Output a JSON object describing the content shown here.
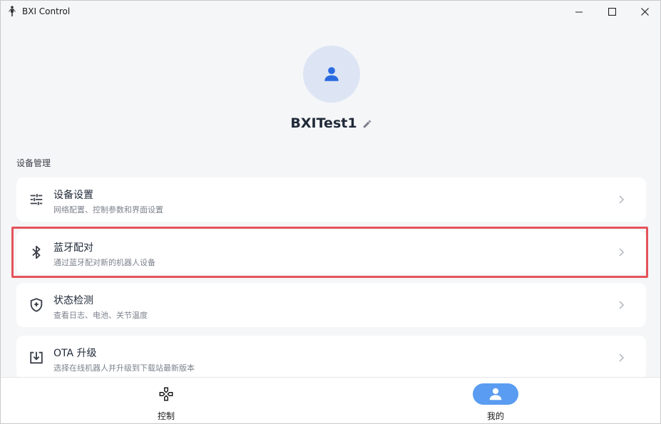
{
  "window": {
    "title": "BXI Control",
    "app_icon": "robot-figure-icon",
    "controls": [
      "minimize-icon",
      "maximize-icon",
      "close-icon"
    ]
  },
  "profile": {
    "avatar_icon": "person-icon",
    "username": "BXITest1",
    "edit_icon": "pencil-icon"
  },
  "section": {
    "label": "设备管理"
  },
  "cards": [
    {
      "icon": "sliders-icon",
      "title": "设备设置",
      "subtitle": "网络配置、控制参数和界面设置"
    },
    {
      "icon": "bluetooth-icon",
      "title": "蓝牙配对",
      "subtitle": "通过蓝牙配对新的机器人设备",
      "highlighted": true
    },
    {
      "icon": "shield-plus-icon",
      "title": "状态检测",
      "subtitle": "查看日志、电池、关节温度"
    },
    {
      "icon": "download-box-icon",
      "title": "OTA 升级",
      "subtitle": "选择在线机器人并升级到下载站最新版本"
    }
  ],
  "bottom_nav": [
    {
      "icon": "gamepad-icon",
      "label": "控制",
      "active": false
    },
    {
      "icon": "person-icon",
      "label": "我的",
      "active": true
    }
  ],
  "colors": {
    "accent": "#5a9cf1",
    "avatar_bg": "#dde5f4",
    "avatar_icon": "#2a6be0",
    "highlight_border": "#e5535a",
    "page_bg": "#f5f6f8"
  }
}
